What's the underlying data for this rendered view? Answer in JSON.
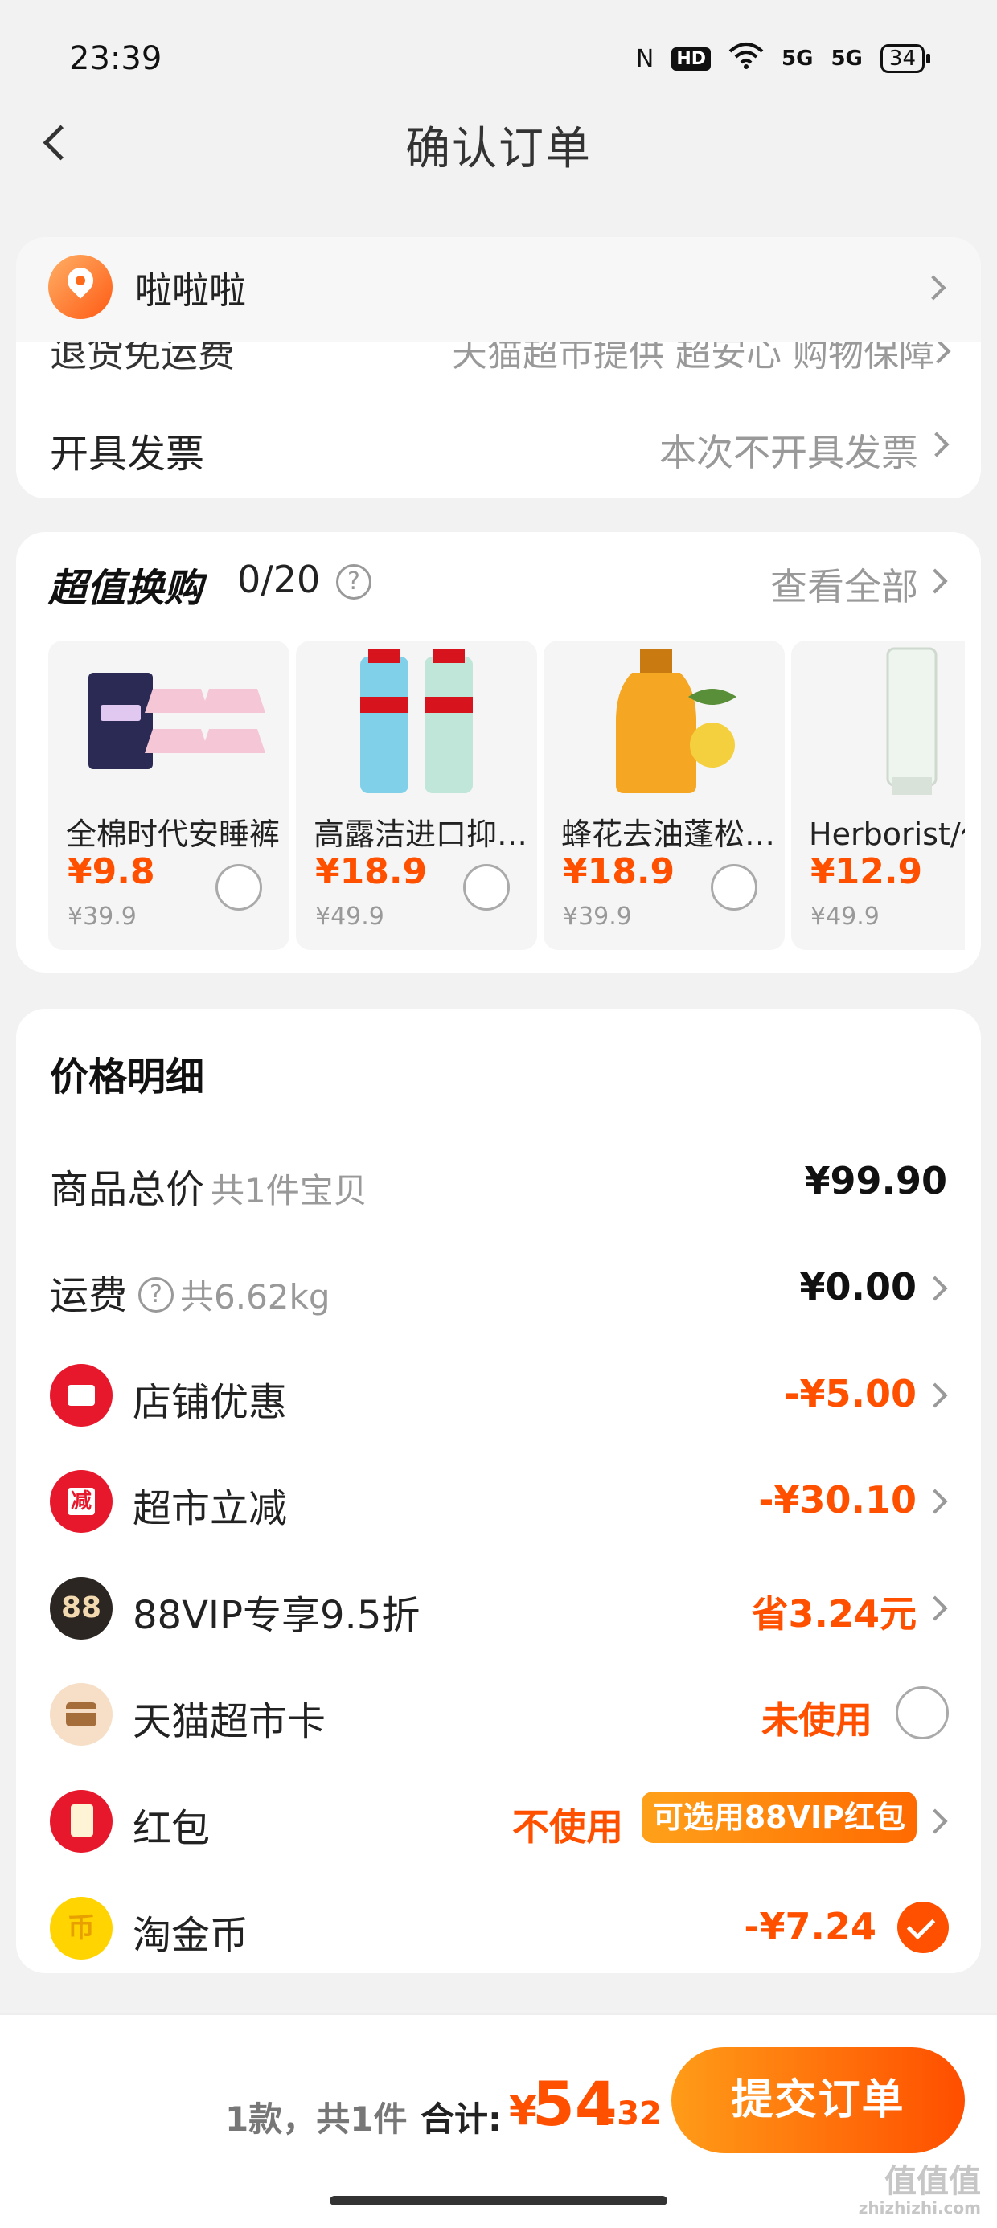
{
  "status": {
    "time": "23:39",
    "hd": "HD",
    "net1": "5G",
    "net2": "5G",
    "battery": "34"
  },
  "nav": {
    "title": "确认订单"
  },
  "address": {
    "name": "啦啦啦"
  },
  "info_rows": [
    {
      "label": "退货免运费",
      "value": "天猫超市提供 超安心 购物保障"
    },
    {
      "label": "开具发票",
      "value": "本次不开具发票"
    }
  ],
  "swap": {
    "title": "超值换购",
    "count": "0/20",
    "view_all": "查看全部",
    "products": [
      {
        "name": "全棉时代安睡裤",
        "price": "¥9.8",
        "original": "¥39.9"
      },
      {
        "name": "高露洁进口抑菌漱口水",
        "price": "¥18.9",
        "original": "¥49.9"
      },
      {
        "name": "蜂花去油蓬松洗发水",
        "price": "¥18.9",
        "original": "¥39.9"
      },
      {
        "name": "Herborist/佰草集",
        "price": "¥12.9",
        "original": "¥49.9"
      }
    ]
  },
  "price_detail": {
    "title": "价格明细",
    "goods_total": {
      "label": "商品总价",
      "sub": "共1件宝贝",
      "value": "¥99.90"
    },
    "shipping": {
      "label": "运费",
      "sub": "共6.62kg",
      "value": "¥0.00"
    },
    "shop_discount": {
      "label": "店铺优惠",
      "value": "-¥5.00"
    },
    "market_cut": {
      "label": "超市立减",
      "value": "-¥30.10"
    },
    "vip": {
      "label": "88VIP专享9.5折",
      "value": "省3.24元",
      "icon_text": "88"
    },
    "card": {
      "label": "天猫超市卡",
      "value": "未使用"
    },
    "redpacket": {
      "label": "红包",
      "value": "不使用",
      "tag": "可选用88VIP红包"
    },
    "coin": {
      "label": "淘金币",
      "value": "-¥7.24"
    }
  },
  "bottom": {
    "count": "1款，共1件",
    "total_label": "合计:",
    "currency": "¥",
    "total_int": "54",
    "total_dec": ".32",
    "submit": "提交订单",
    "watermark": "值值值",
    "watermark_url": "zhizhizhi.com"
  },
  "colors": {
    "accent": "#ff5000",
    "background": "#f2f2f2",
    "card": "#ffffff"
  }
}
